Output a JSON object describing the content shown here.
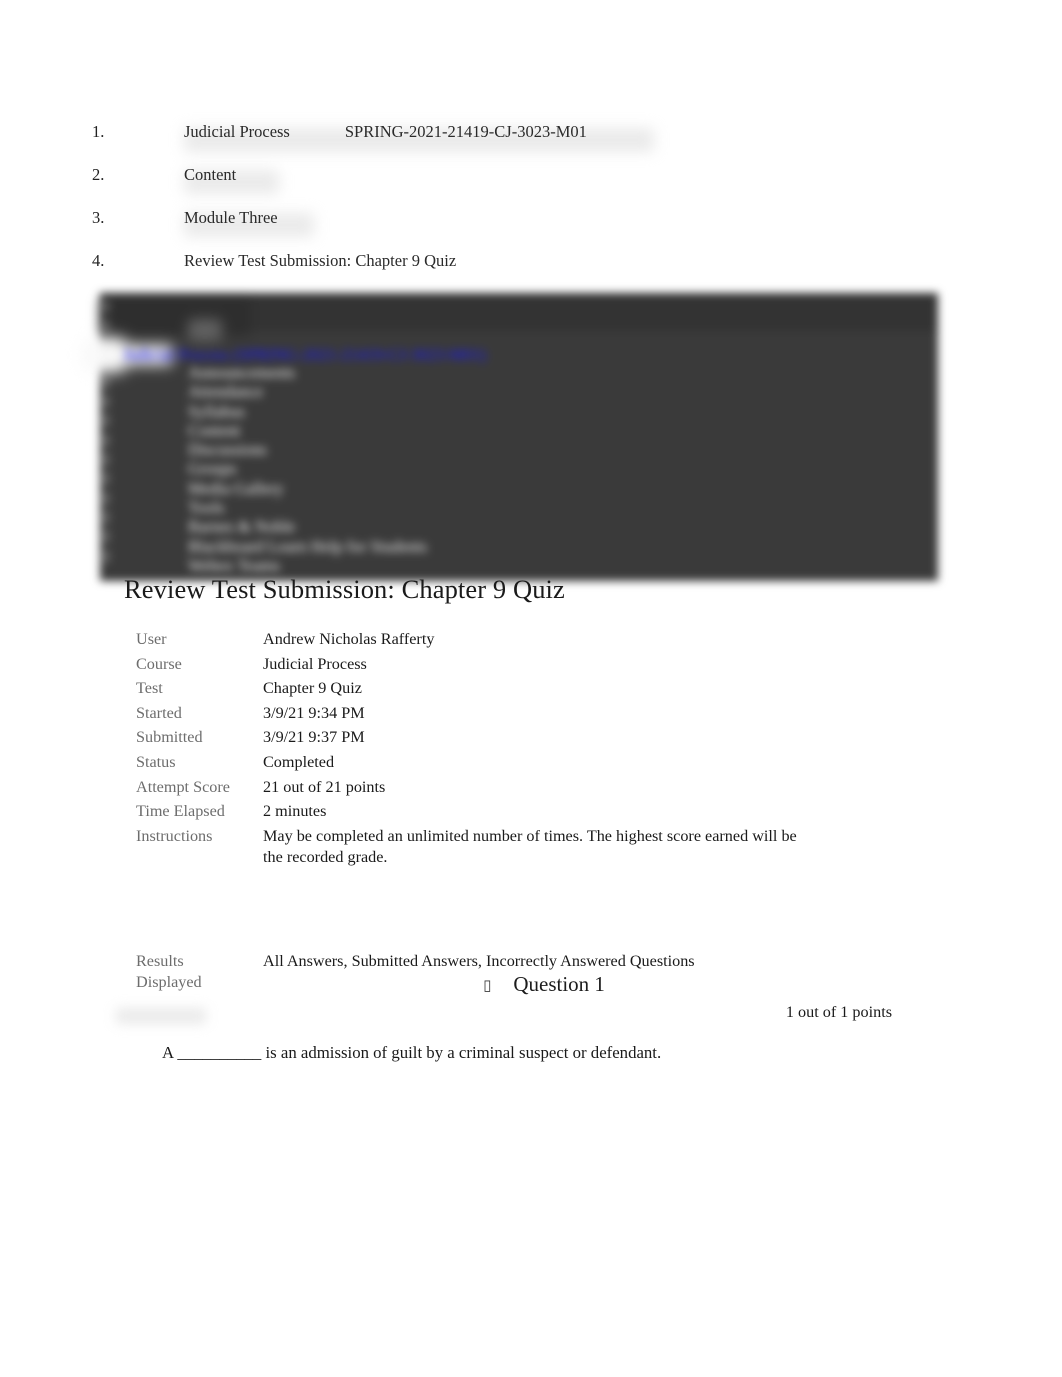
{
  "breadcrumb": {
    "items": [
      {
        "number": "1.",
        "label": "Judicial Process",
        "code": "SPRING-2021-21419-CJ-3023-M01"
      },
      {
        "number": "2.",
        "label": "Content",
        "code": ""
      },
      {
        "number": "3.",
        "label": "Module Three",
        "code": ""
      },
      {
        "number": "4.",
        "label": "Review Test Submission: Chapter 9 Quiz",
        "code": ""
      }
    ]
  },
  "course_nav": {
    "course_link": "Judicial Process (SPRING-2021-21419-CJ-3023-M01)",
    "link_color": "#1414ff",
    "panel_color": "#3a3a3a",
    "glyph": "▯",
    "glyph_count": 13,
    "items": [
      "Announcements",
      "Attendance",
      "Syllabus",
      "Content",
      "Discussions",
      "Groups",
      "Media Gallery",
      "Tools",
      "Barnes & Noble",
      "Blackboard Learn Help for Students",
      "Webex Teams"
    ]
  },
  "page": {
    "title": "Review Test Submission: Chapter 9 Quiz"
  },
  "submission": {
    "rows": [
      {
        "label": "User",
        "value": "Andrew Nicholas Rafferty"
      },
      {
        "label": "Course",
        "value": "Judicial Process"
      },
      {
        "label": "Test",
        "value": "Chapter 9 Quiz"
      },
      {
        "label": "Started",
        "value": "3/9/21 9:34 PM"
      },
      {
        "label": "Submitted",
        "value": "3/9/21 9:37 PM"
      },
      {
        "label": "Status",
        "value": "Completed"
      },
      {
        "label": "Attempt Score",
        "value": "21 out of 21 points"
      },
      {
        "label": "Time Elapsed",
        "value": "2 minutes"
      }
    ],
    "instructions_label": "Instructions",
    "instructions_value": "May be completed an unlimited number of times. The highest score earned will be the recorded grade.",
    "results_label_line1": "Results",
    "results_label_line2": "Displayed",
    "results_value": "All Answers, Submitted Answers, Incorrectly Answered Questions"
  },
  "question": {
    "glyph": "▯",
    "heading": "Question 1",
    "points": "1 out of 1 points",
    "text": "A __________ is an admission of guilt by a criminal suspect or defendant."
  }
}
